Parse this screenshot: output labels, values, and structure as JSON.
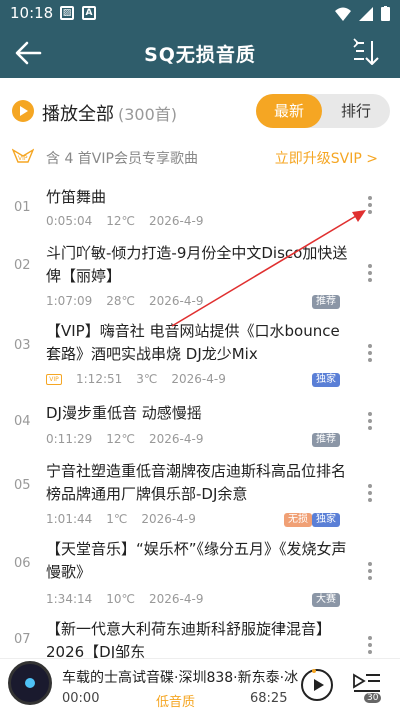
{
  "status": {
    "time": "10:18"
  },
  "header": {
    "title": "SQ无损音质"
  },
  "play_all": {
    "label": "播放全部",
    "count": "(300首)"
  },
  "sort_tabs": {
    "latest": "最新",
    "ranking": "排行"
  },
  "vip_banner": {
    "text": "含 4 首VIP会员专享歌曲",
    "link": "立即升级SVIP >"
  },
  "songs": [
    {
      "index": "01",
      "title": "竹笛舞曲",
      "duration": "0:05:04",
      "temp": "12℃",
      "date": "2026-4-9",
      "badges": []
    },
    {
      "index": "02",
      "title": "斗门吖敏-倾力打造-9月份全中文Disco加快送俾【丽婷】",
      "duration": "1:07:09",
      "temp": "28℃",
      "date": "2026-4-9",
      "badges": [
        "推荐"
      ]
    },
    {
      "index": "03",
      "title": "【VIP】嗨音社 电音网站提供《口水bounce套路》酒吧实战串烧 DJ龙少Mix",
      "duration": "1:12:51",
      "temp": "3℃",
      "date": "2026-4-9",
      "badges": [
        "独家"
      ],
      "vip": "VIP"
    },
    {
      "index": "04",
      "title": "DJ漫步重低音 动感慢摇",
      "duration": "0:11:29",
      "temp": "12℃",
      "date": "2026-4-9",
      "badges": [
        "推荐"
      ]
    },
    {
      "index": "05",
      "title": "宁音社塑造重低音潮牌夜店迪斯科高品位排名榜品牌通用厂牌俱乐部-DJ余意",
      "duration": "1:01:44",
      "temp": "1℃",
      "date": "2026-4-9",
      "badges": [
        "无损",
        "独家"
      ]
    },
    {
      "index": "06",
      "title": "【天堂音乐】“娱乐杯”《缘分五月》《发烧女声慢歌》",
      "duration": "1:34:14",
      "temp": "10℃",
      "date": "2026-4-9",
      "badges": [
        "大赛"
      ]
    },
    {
      "index": "07",
      "title": "【新一代意大利荷东迪斯科舒服旋律混音】 2026【DJ邹东",
      "duration": "",
      "temp": "",
      "date": "",
      "badges": []
    }
  ],
  "player": {
    "title": "车载的士高试音碟·深圳838·新东泰·冰",
    "time_start": "00:00",
    "quality": "低音质",
    "time_end": "68:25",
    "queue_count": "30"
  },
  "colors": {
    "header_bg": "#2f5d6b",
    "accent": "#f5a623",
    "annotation_arrow": "#e03030"
  },
  "icons": [
    "back-arrow-icon",
    "sort-download-icon",
    "play-circle-icon",
    "vip-icon",
    "more-vertical-icon",
    "play-icon",
    "playlist-icon"
  ]
}
